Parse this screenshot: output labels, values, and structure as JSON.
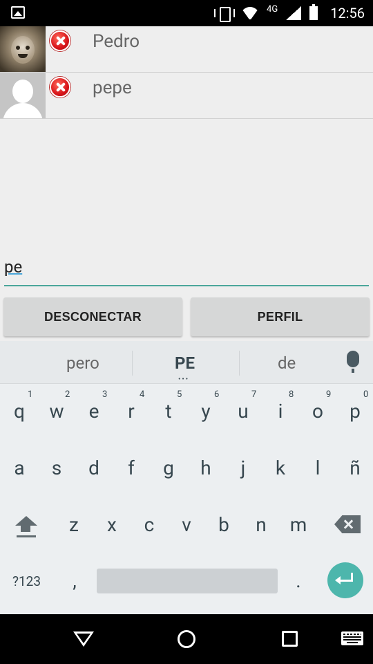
{
  "status_bar": {
    "network_label": "4G",
    "time": "12:56"
  },
  "contacts": [
    {
      "name": "Pedro",
      "avatar": "photo"
    },
    {
      "name": "pepe",
      "avatar": "default-silhouette"
    }
  ],
  "message_input": {
    "value": "pe"
  },
  "buttons": {
    "disconnect": "DESCONECTAR",
    "profile": "PERFIL"
  },
  "keyboard": {
    "suggestions": [
      "pero",
      "PE",
      "de"
    ],
    "suggestion_more_indicator": "•••",
    "row1": [
      "q",
      "w",
      "e",
      "r",
      "t",
      "y",
      "u",
      "i",
      "o",
      "p"
    ],
    "row1_hints": [
      "1",
      "2",
      "3",
      "4",
      "5",
      "6",
      "7",
      "8",
      "9",
      "0"
    ],
    "row2": [
      "a",
      "s",
      "d",
      "f",
      "g",
      "h",
      "j",
      "k",
      "l",
      "ñ"
    ],
    "row3": [
      "z",
      "x",
      "c",
      "v",
      "b",
      "n",
      "m"
    ],
    "symbols_key": "?123",
    "comma": ",",
    "period": ".",
    "enter_color": "#4db6ac"
  },
  "colors": {
    "input_underline": "#4aa69a",
    "remove_icon": "#d8141a"
  }
}
